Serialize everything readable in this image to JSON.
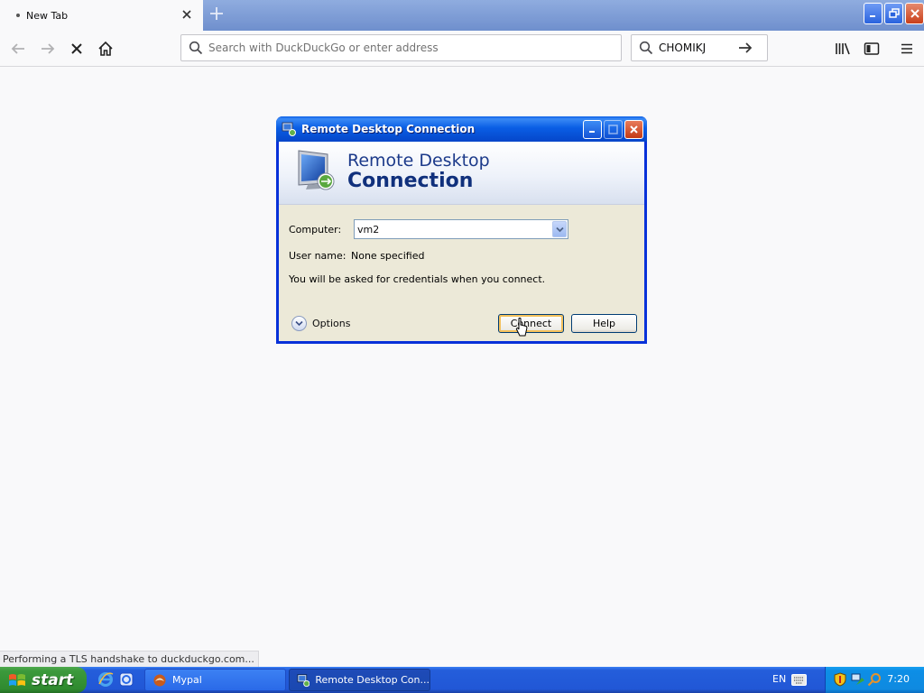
{
  "browser": {
    "tab": {
      "title": "New Tab"
    },
    "urlbar": {
      "placeholder": "Search with DuckDuckGo or enter address"
    },
    "searchbar": {
      "value": "CHOMIKJ"
    },
    "status": "Performing a TLS handshake to duckduckgo.com..."
  },
  "dialog": {
    "title": "Remote Desktop Connection",
    "banner": {
      "line1": "Remote Desktop",
      "line2": "Connection"
    },
    "computer_label": "Computer:",
    "computer_value": "vm2",
    "username_label": "User name:",
    "username_value": "None specified",
    "info": "You will be asked for credentials when you connect.",
    "options_label": "Options",
    "connect_label": "Connect",
    "help_label": "Help"
  },
  "taskbar": {
    "start_label": "start",
    "items": [
      {
        "label": "Mypal",
        "state": "inactive"
      },
      {
        "label": "Remote Desktop Con...",
        "state": "active"
      }
    ],
    "language": "EN",
    "clock": "7:20"
  },
  "colors": {
    "xp_blue": "#245edb",
    "start_green": "#3c9a3c",
    "title_blue": "#0a5ee5"
  }
}
